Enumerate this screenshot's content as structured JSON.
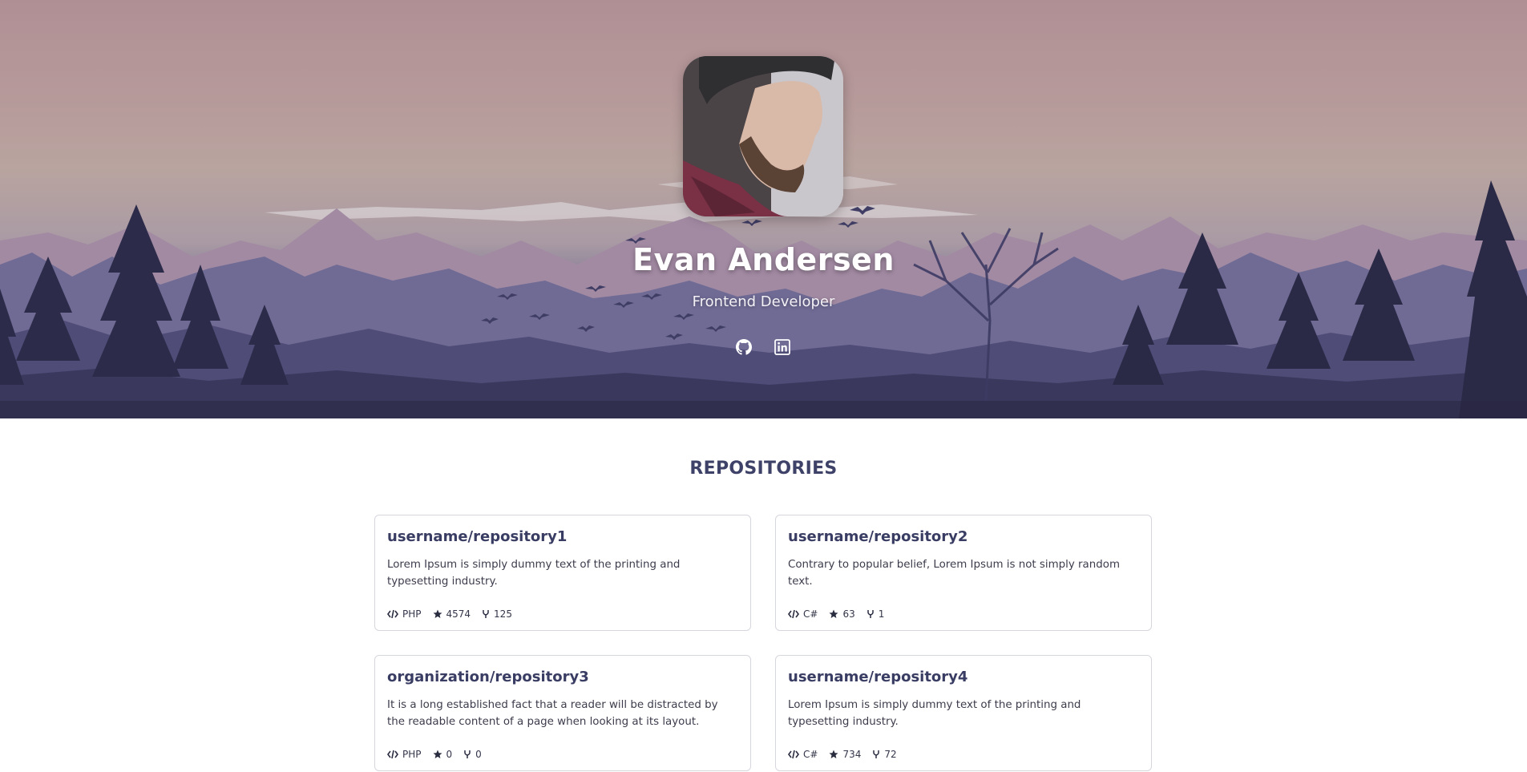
{
  "profile": {
    "name": "Evan Andersen",
    "role": "Frontend Developer"
  },
  "social": [
    {
      "icon": "github-icon"
    },
    {
      "icon": "linkedin-icon"
    }
  ],
  "repositories_section": {
    "title": "REPOSITORIES",
    "items": [
      {
        "name": "username/repository1",
        "description": "Lorem Ipsum is simply dummy text of the printing and typesetting industry.",
        "language": "PHP",
        "stars": "4574",
        "forks": "125"
      },
      {
        "name": "username/repository2",
        "description": "Contrary to popular belief, Lorem Ipsum is not simply random text.",
        "language": "C#",
        "stars": "63",
        "forks": "1"
      },
      {
        "name": "organization/repository3",
        "description": "It is a long established fact that a reader will be distracted by the readable content of a page when looking at its layout.",
        "language": "PHP",
        "stars": "0",
        "forks": "0"
      },
      {
        "name": "username/repository4",
        "description": "Lorem Ipsum is simply dummy text of the printing and typesetting industry.",
        "language": "C#",
        "stars": "734",
        "forks": "72"
      }
    ]
  },
  "colors": {
    "accent": "#3f4268",
    "card_border": "#d6d7de",
    "hero_sky": "#b08f94",
    "hero_mountains": "#5d5a86"
  }
}
